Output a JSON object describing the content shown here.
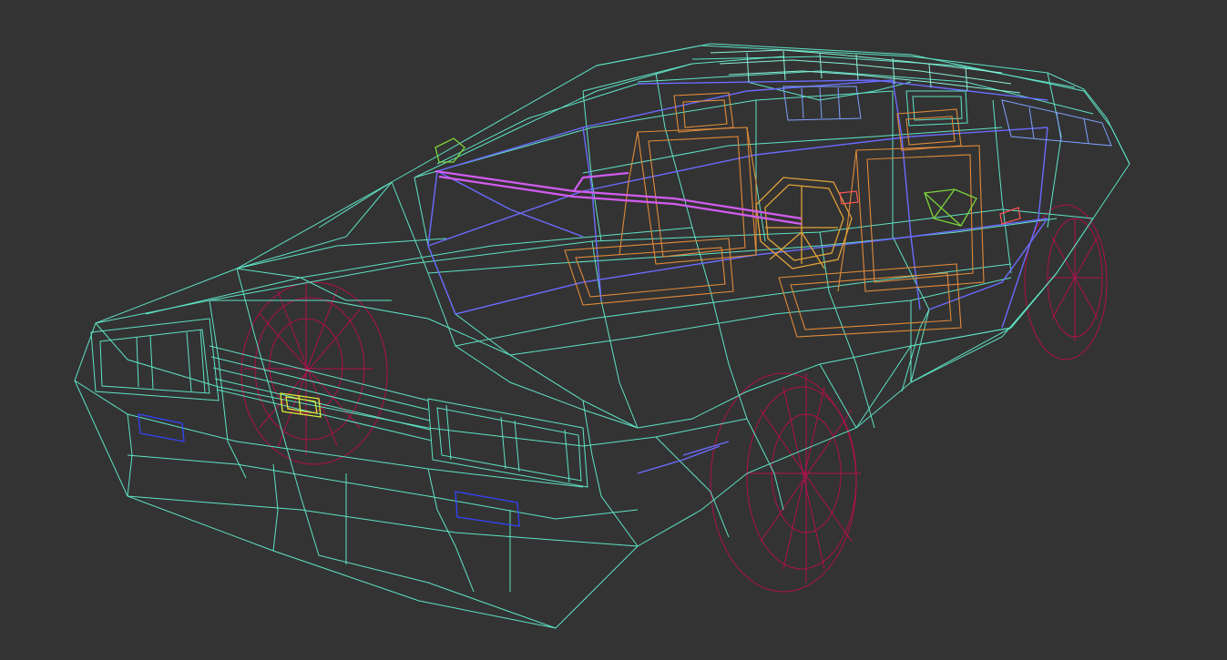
{
  "viewport": {
    "background": "#333333",
    "view_mode": "wireframe",
    "subject": "car-wireframe-model"
  },
  "layer_colors": {
    "body": "#5ee3c6",
    "body_highlight": "#8af0d8",
    "frame": "#6b6bff",
    "glass": "#7fa0ff",
    "seats": "#e08a3a",
    "steering": "#e0a13a",
    "wheels": "#b0104c",
    "accent_magenta": "#d25cf0",
    "accent_green": "#7cd43a",
    "accent_yellow": "#d8e83a",
    "trim_blue": "#3344ff",
    "red_part": "#ff5555"
  }
}
